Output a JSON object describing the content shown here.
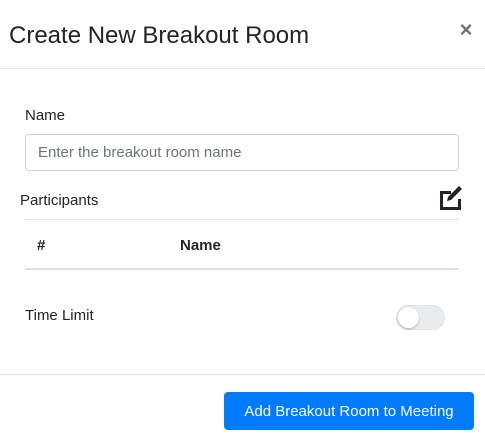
{
  "header": {
    "title": "Create New Breakout Room",
    "close_symbol": "×"
  },
  "form": {
    "name_label": "Name",
    "name_input": {
      "value": "",
      "placeholder": "Enter the breakout room name"
    },
    "participants_label": "Participants",
    "participants_table": {
      "columns": [
        "#",
        "Name"
      ],
      "rows": []
    },
    "time_limit_label": "Time Limit",
    "time_limit_enabled": false
  },
  "footer": {
    "submit_label": "Add Breakout Room to Meeting"
  },
  "icons": {
    "edit": "edit-icon",
    "close": "close-icon"
  },
  "colors": {
    "primary": "#007bff",
    "border": "#dee2e6",
    "text": "#212529"
  }
}
